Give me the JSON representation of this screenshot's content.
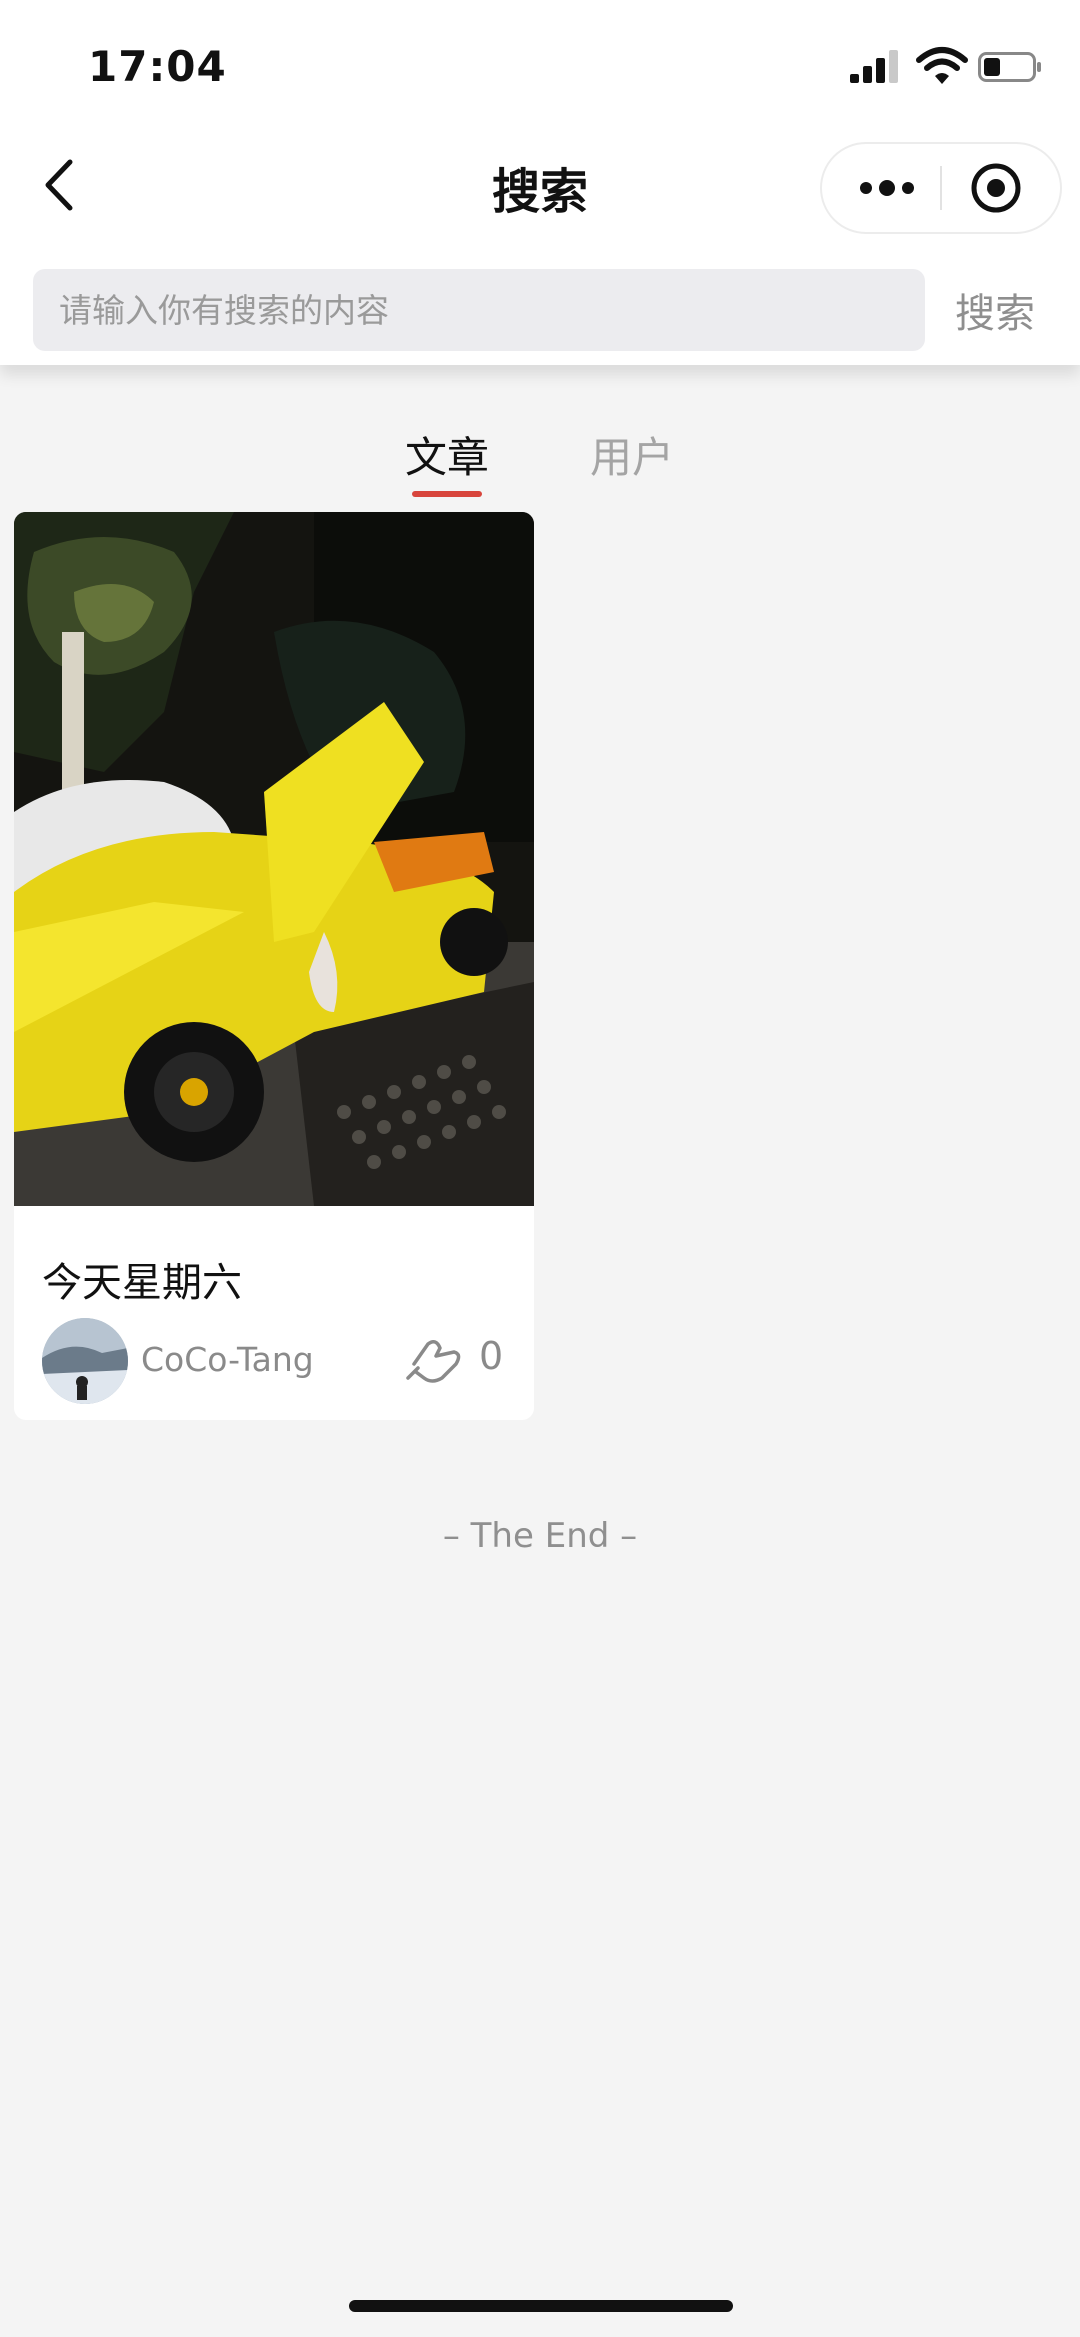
{
  "status_bar": {
    "time": "17:04"
  },
  "nav": {
    "title": "搜索"
  },
  "search": {
    "placeholder": "请输入你有搜索的内容",
    "button_label": "搜索"
  },
  "tabs": [
    {
      "label": "文章",
      "active": true
    },
    {
      "label": "用户",
      "active": false
    }
  ],
  "results": [
    {
      "title": "今天星期六",
      "author": "CoCo-Tang",
      "likes": "0"
    }
  ],
  "footer": {
    "end_text": "– The End –"
  },
  "colors": {
    "accent": "#d8453c",
    "background": "#f4f4f4"
  },
  "icons": [
    "back-icon",
    "more-icon",
    "target-icon",
    "like-icon",
    "signal-icon",
    "wifi-icon",
    "battery-icon"
  ]
}
